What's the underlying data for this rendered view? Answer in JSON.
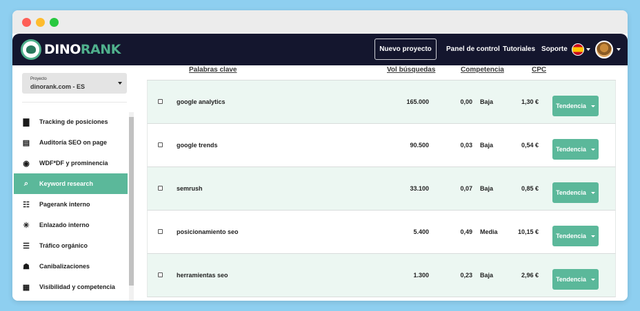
{
  "header": {
    "logo_left": "DINO",
    "logo_right": "RANK",
    "new_project": "Nuevo proyecto",
    "nav": [
      "Panel de control",
      "Tutoriales",
      "Soporte"
    ]
  },
  "sidebar": {
    "project_label": "Proyecto",
    "project_name": "dinorank.com - ES",
    "items": [
      {
        "label": "Tracking de posiciones",
        "icon": "bar-chart-icon"
      },
      {
        "label": "Auditoría SEO on page",
        "icon": "document-chart-icon"
      },
      {
        "label": "WDF*DF y prominencia",
        "icon": "target-icon"
      },
      {
        "label": "Keyword research",
        "icon": "keyword-search-icon",
        "active": true
      },
      {
        "label": "Pagerank interno",
        "icon": "sitemap-icon"
      },
      {
        "label": "Enlazado interno",
        "icon": "network-icon"
      },
      {
        "label": "Tráfico orgánico",
        "icon": "traffic-light-icon"
      },
      {
        "label": "Canibalizaciones",
        "icon": "cannibal-icon"
      },
      {
        "label": "Visibilidad y competencia",
        "icon": "report-icon"
      }
    ]
  },
  "table": {
    "columns": {
      "keyword": "Palabras clave",
      "volume": "Vol búsquedas",
      "competition": "Competencia",
      "cpc": "CPC"
    },
    "trend_label": "Tendencia",
    "rows": [
      {
        "keyword": "google analytics",
        "volume": "165.000",
        "competition": "0,00",
        "level": "Baja",
        "cpc": "1,30 €"
      },
      {
        "keyword": "google trends",
        "volume": "90.500",
        "competition": "0,03",
        "level": "Baja",
        "cpc": "0,54 €"
      },
      {
        "keyword": "semrush",
        "volume": "33.100",
        "competition": "0,07",
        "level": "Baja",
        "cpc": "0,85 €"
      },
      {
        "keyword": "posicionamiento seo",
        "volume": "5.400",
        "competition": "0,49",
        "level": "Media",
        "cpc": "10,15 €"
      },
      {
        "keyword": "herramientas seo",
        "volume": "1.300",
        "competition": "0,23",
        "level": "Baja",
        "cpc": "2,96 €"
      }
    ]
  },
  "colors": {
    "accent": "#5bb89a",
    "navbar": "#14162e",
    "row_alt": "#ecf7f2",
    "background": "#8ecff0"
  }
}
